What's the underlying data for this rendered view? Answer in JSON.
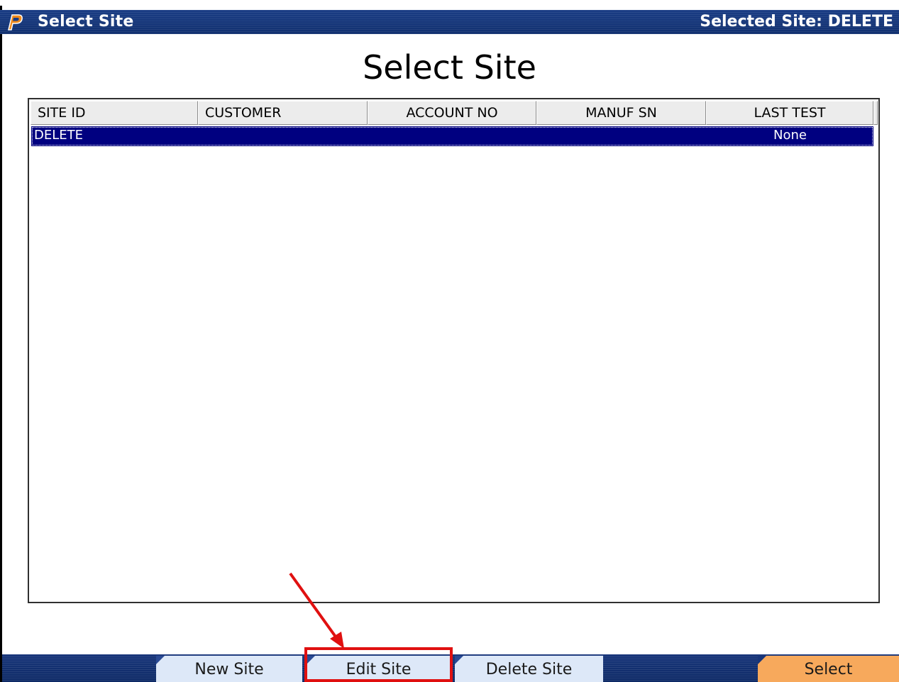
{
  "window": {
    "title": "Select Site",
    "selected_site_text": "Selected Site: DELETE"
  },
  "page": {
    "heading": "Select Site"
  },
  "table": {
    "columns": [
      "SITE ID",
      "CUSTOMER",
      "ACCOUNT NO",
      "MANUF SN",
      "LAST TEST"
    ],
    "rows": [
      {
        "site_id": "DELETE",
        "customer": "",
        "account_no": "",
        "manuf_sn": "",
        "last_test": "None",
        "selected": true
      }
    ]
  },
  "buttons": {
    "new_site": "New Site",
    "edit_site": "Edit Site",
    "delete_site": "Delete Site",
    "select": "Select"
  },
  "icons": {
    "app_logo": "p-logo-icon"
  },
  "colors": {
    "titlebar": "#11306f",
    "selection": "#000080",
    "tab_blue": "#dde8f8",
    "tab_orange": "#f7a95c",
    "annotation": "#e01010"
  }
}
